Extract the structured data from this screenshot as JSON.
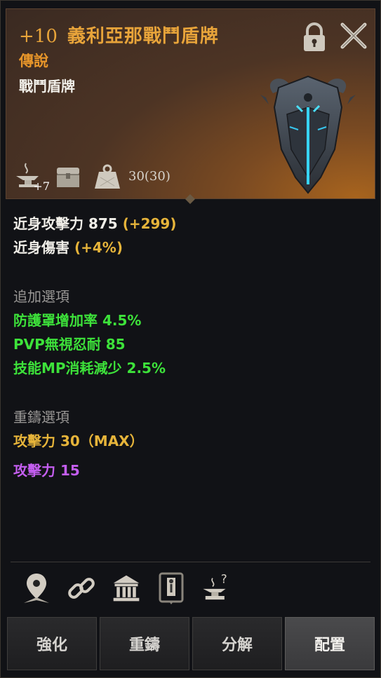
{
  "item": {
    "enhance": "+10",
    "name": "義利亞那戰鬥盾牌",
    "grade": "傳說",
    "type": "戰鬥盾牌",
    "enchant_badge": "+7",
    "weight": "30(30)",
    "icons": [
      "anvil-icon",
      "chest-icon",
      "weight-icon",
      "lock-icon",
      "close-icon",
      "shield-item-image"
    ]
  },
  "stats": {
    "melee_attack_label": "近身攻擊力 875",
    "melee_attack_bonus": "(+299)",
    "melee_damage_label": "近身傷害",
    "melee_damage_bonus": "(+4%)"
  },
  "additional": {
    "header": "追加選項",
    "options": [
      "防護罩增加率 4.5%",
      "PVP無視忍耐 85",
      "技能MP消耗減少 2.5%"
    ]
  },
  "reforge": {
    "header": "重鑄選項",
    "option_max": "攻擊力 30（MAX）",
    "option_2": "攻擊力 15"
  },
  "action_icons": [
    "location-pin-icon",
    "link-icon",
    "bank-icon",
    "codex-icon",
    "anvil-help-icon"
  ],
  "buttons": {
    "enhance": "強化",
    "reforge": "重鑄",
    "dismantle": "分解",
    "equip": "配置"
  },
  "colors": {
    "title": "#e8a43a",
    "bonus": "#e6b43a",
    "additional": "#3de23a",
    "reforge2": "#c45ef0"
  }
}
